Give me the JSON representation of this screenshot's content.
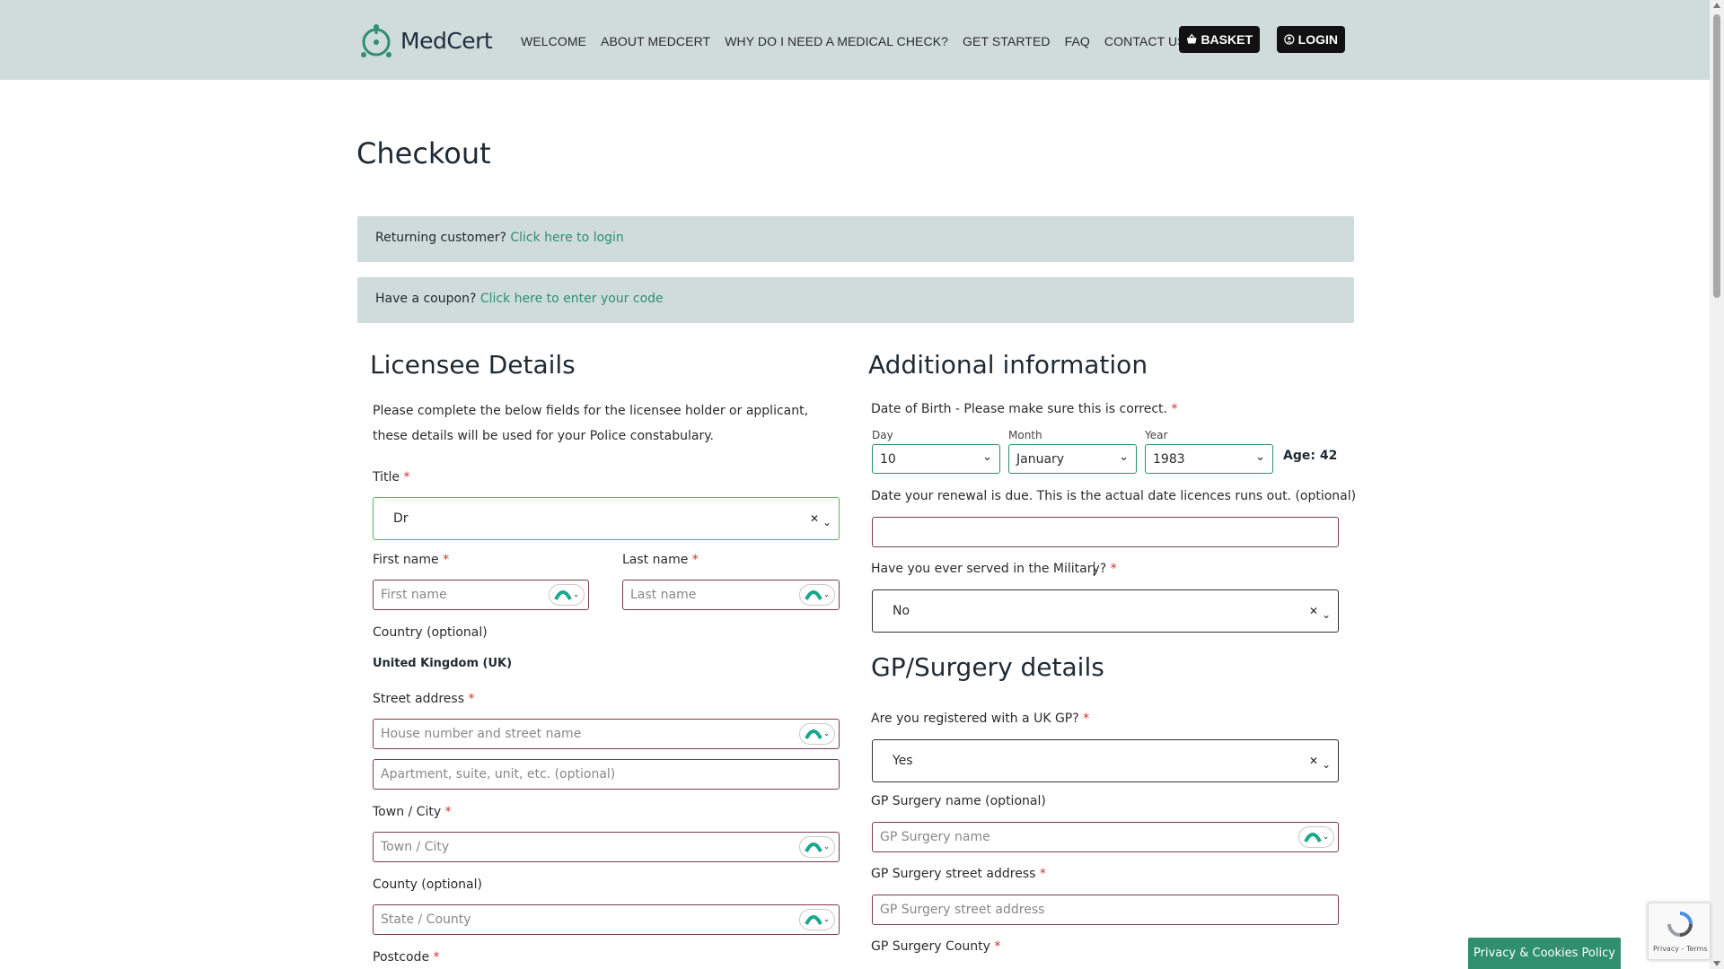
{
  "header": {
    "brand": "MedCert",
    "nav": [
      "WELCOME",
      "ABOUT MEDCERT",
      "WHY DO I NEED A MEDICAL CHECK?",
      "GET STARTED",
      "FAQ",
      "CONTACT US"
    ],
    "basket_label": "BASKET",
    "login_label": "LOGIN",
    "bg_color": "#cfdcdb"
  },
  "page": {
    "title": "Checkout"
  },
  "notices": {
    "returning_text": "Returning customer?",
    "returning_link": "Click here to login",
    "coupon_text": "Have a coupon?",
    "coupon_link": "Click here to enter your code"
  },
  "licensee": {
    "heading": "Licensee Details",
    "intro": "Please complete the below fields for the licensee holder or applicant, these details will be used for your Police constabulary.",
    "title_label": "Title",
    "title_value": "Dr",
    "first_name_label": "First name",
    "first_name_placeholder": "First name",
    "last_name_label": "Last name",
    "last_name_placeholder": "Last name",
    "country_label": "Country (optional)",
    "country_value": "United Kingdom (UK)",
    "street_label": "Street address",
    "street_placeholder_1": "House number and street name",
    "street_placeholder_2": "Apartment, suite, unit, etc. (optional)",
    "town_label": "Town / City",
    "town_placeholder": "Town / City",
    "county_label": "County (optional)",
    "county_placeholder": "State / County",
    "postcode_label": "Postcode"
  },
  "additional": {
    "heading": "Additional information",
    "dob_label": "Date of Birth - Please make sure this is correct.",
    "day_label": "Day",
    "day_value": "10",
    "month_label": "Month",
    "month_value": "January",
    "year_label": "Year",
    "year_value": "1983",
    "age_text": "Age: 42",
    "renewal_label": "Date your renewal is due. This is the actual date licences runs out. (optional)",
    "military_label": "Have you ever served in the Military?",
    "military_value": "No"
  },
  "gp": {
    "heading": "GP/Surgery details",
    "registered_label": "Are you registered with a UK GP?",
    "registered_value": "Yes",
    "surgery_name_label": "GP Surgery name (optional)",
    "surgery_name_placeholder": "GP Surgery name",
    "street_label": "GP Surgery street address",
    "street_placeholder": "GP Surgery street address",
    "county_label": "GP Surgery County"
  },
  "footer": {
    "privacy_label": "Privacy & Cookies Policy",
    "recaptcha_text": "Privacy - Terms"
  },
  "colors": {
    "accent": "#2f8f6f",
    "required": "#d6312c"
  }
}
